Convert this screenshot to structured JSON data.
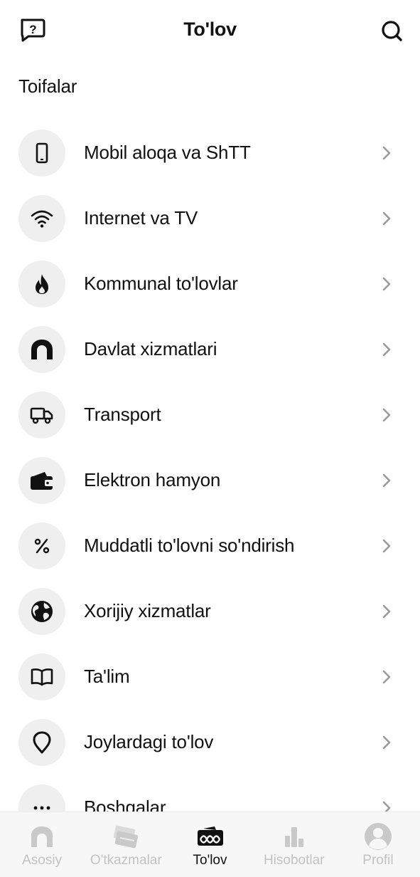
{
  "header": {
    "title": "To'lov",
    "help_icon": "question-chat-icon",
    "search_icon": "search-icon"
  },
  "section_title": "Toifalar",
  "categories": [
    {
      "label": "Mobil aloqa va ShTT",
      "icon": "smartphone-icon"
    },
    {
      "label": "Internet va TV",
      "icon": "wifi-icon"
    },
    {
      "label": "Kommunal to'lovlar",
      "icon": "flame-icon"
    },
    {
      "label": "Davlat xizmatlari",
      "icon": "arch-icon"
    },
    {
      "label": "Transport",
      "icon": "truck-icon"
    },
    {
      "label": "Elektron hamyon",
      "icon": "wallet-icon"
    },
    {
      "label": "Muddatli to'lovni so'ndirish",
      "icon": "percent-icon"
    },
    {
      "label": "Xorijiy xizmatlar",
      "icon": "globe-icon"
    },
    {
      "label": "Ta'lim",
      "icon": "book-icon"
    },
    {
      "label": "Joylardagi to'lov",
      "icon": "location-pin-icon"
    },
    {
      "label": "Boshqalar",
      "icon": "more-dots-icon"
    }
  ],
  "bottom_nav": [
    {
      "label": "Asosiy",
      "icon": "home-icon",
      "active": false
    },
    {
      "label": "O'tkazmalar",
      "icon": "cards-icon",
      "active": false
    },
    {
      "label": "To'lov",
      "icon": "payment-icon",
      "active": true
    },
    {
      "label": "Hisobotlar",
      "icon": "bar-chart-icon",
      "active": false
    },
    {
      "label": "Profil",
      "icon": "profile-icon",
      "active": false
    }
  ],
  "colors": {
    "text": "#111111",
    "icon_bg": "#efefef",
    "chevron": "#9a9a9a",
    "nav_inactive": "#c2c2c2",
    "nav_bg": "#f7f7f7"
  }
}
